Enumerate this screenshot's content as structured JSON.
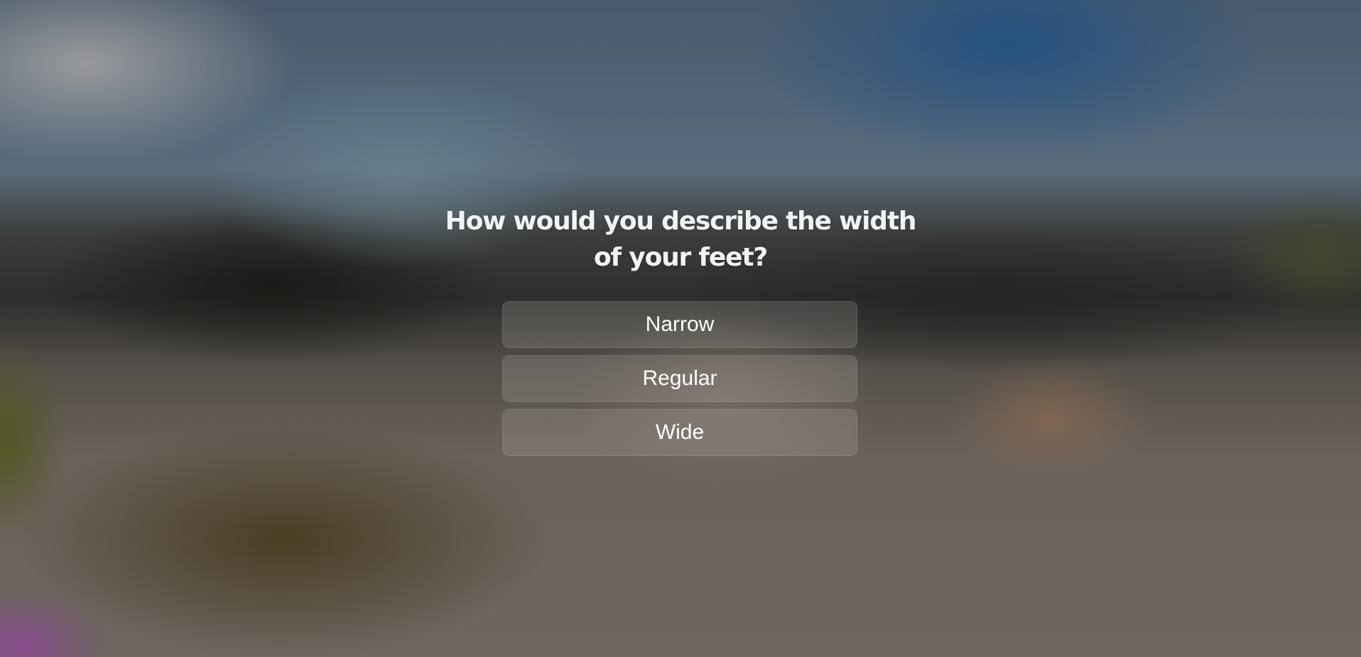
{
  "question": {
    "title": "How would you describe the width of your feet?"
  },
  "options": [
    {
      "label": "Narrow"
    },
    {
      "label": "Regular"
    },
    {
      "label": "Wide"
    }
  ],
  "colors": {
    "text": "#f2f3f4",
    "option_bg": "rgba(205,200,195,0.18)"
  }
}
